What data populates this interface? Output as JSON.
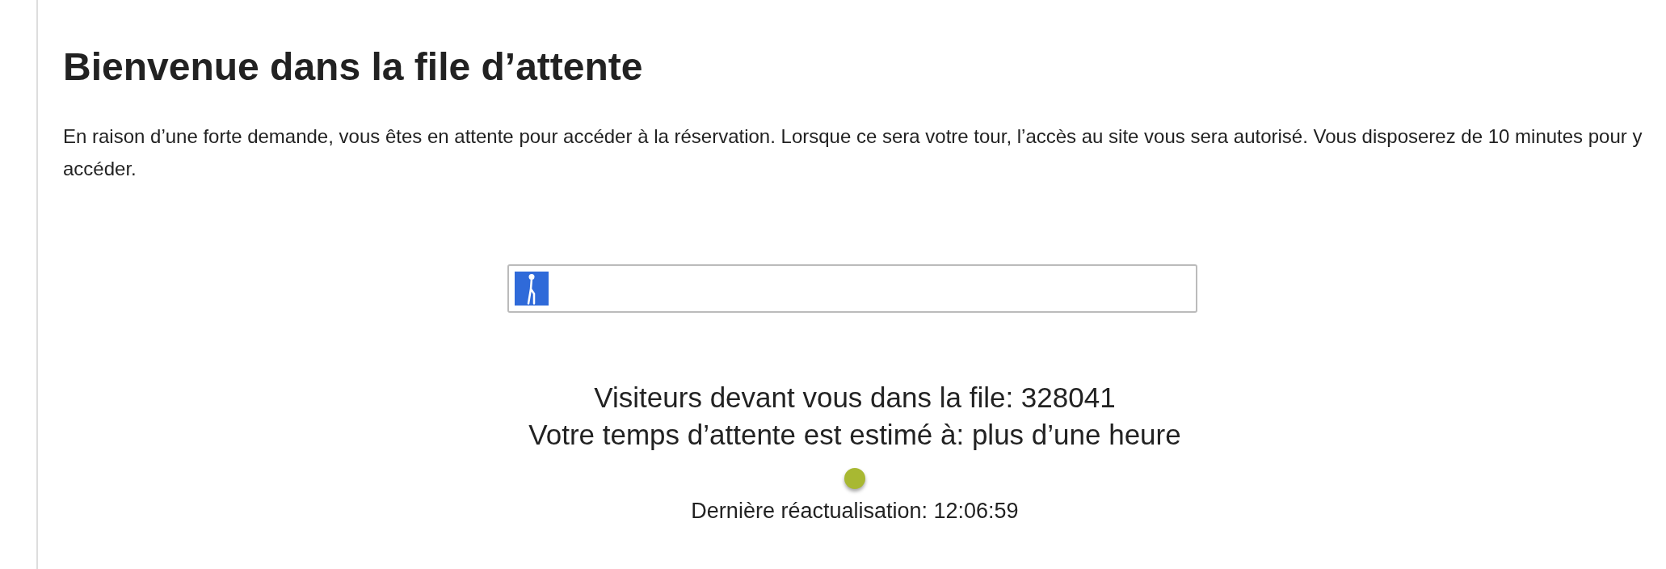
{
  "title": "Bienvenue dans la file d’attente",
  "intro": "En raison d’une forte demande, vous êtes en attente pour accéder à la réservation. Lorsque ce sera votre tour, l’accès au site vous sera autorisé. Vous disposerez de 10 minutes pour y accéder.",
  "progress": {
    "level": 0.05
  },
  "queue_info": [
    "Visiteurs devant vous dans la file: 328041",
    "Votre temps d’attente est estimé à: plus d’une heure"
  ],
  "status_light": {
    "color": "#a8b832"
  },
  "last_refresh": "Dernière réactualisation: 12:06:59"
}
